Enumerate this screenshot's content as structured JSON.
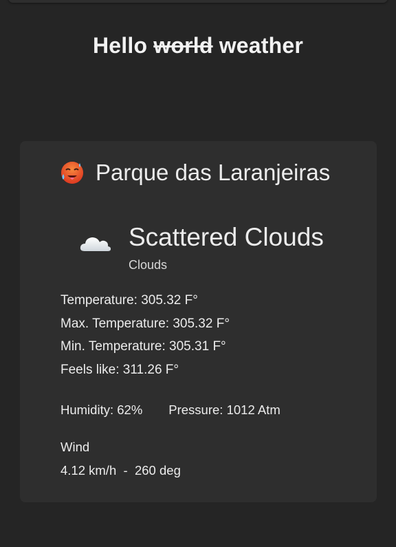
{
  "header": {
    "title_prefix": "Hello",
    "title_struck": "world",
    "title_suffix": "weather"
  },
  "location": {
    "icon": "hot-face-emoji",
    "name": "Parque das Laranjeiras"
  },
  "weather": {
    "icon": "cloud-icon",
    "description": "Scattered Clouds",
    "main": "Clouds"
  },
  "temperatures": {
    "temperature": "Temperature: 305.32 F°",
    "max": "Max. Temperature: 305.32 F°",
    "min": "Min. Temperature: 305.31 F°",
    "feels_like": "Feels like: 311.26 F°"
  },
  "metrics": {
    "humidity": "Humidity: 62%",
    "pressure": "Pressure: 1012 Atm"
  },
  "wind": {
    "label": "Wind",
    "speed": "4.12 km/h",
    "separator": "-",
    "direction": "260 deg"
  },
  "colors": {
    "background": "#252525",
    "card": "#2e2e2e",
    "text": "#ececec"
  }
}
